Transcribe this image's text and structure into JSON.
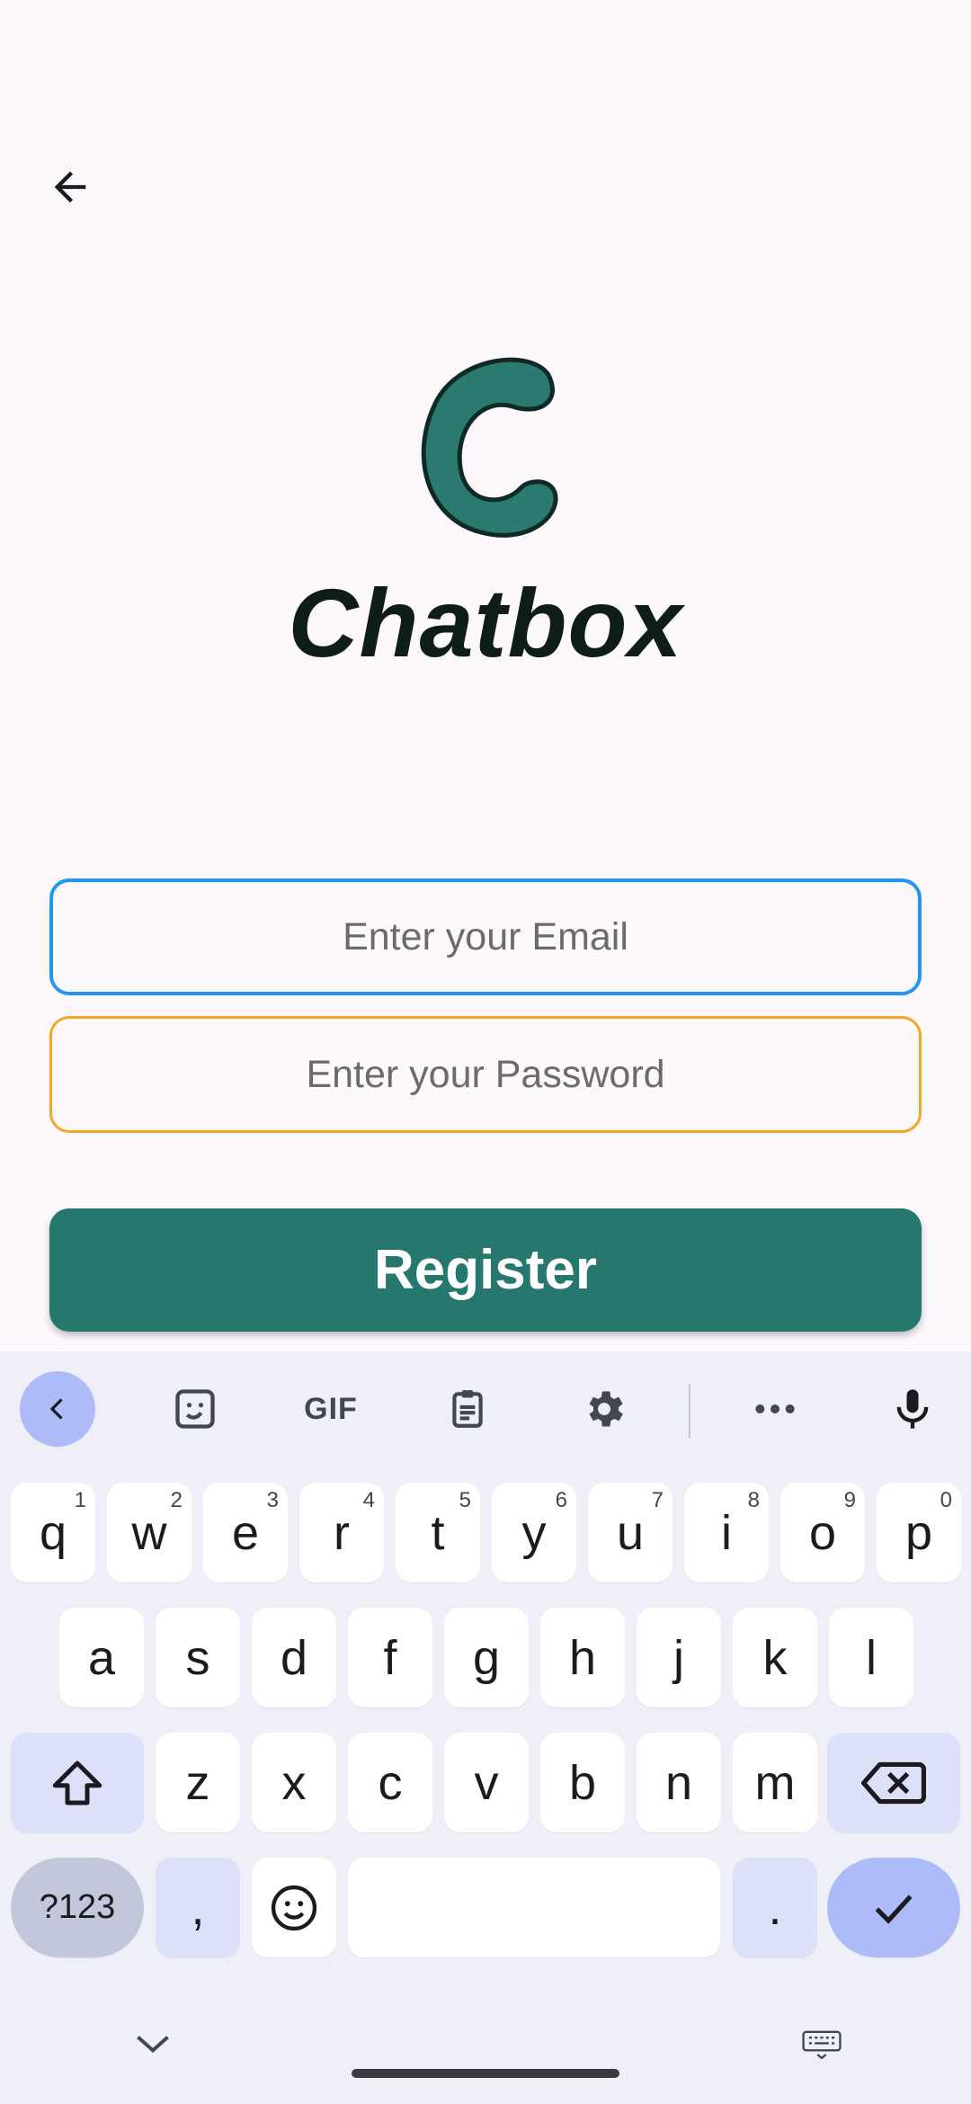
{
  "app": {
    "logo_text": "Chatbox",
    "brand_color": "#26776d",
    "back_icon": "arrow-left-icon"
  },
  "form": {
    "email_placeholder": "Enter your Email",
    "password_placeholder": "Enter your Password",
    "register_label": "Register",
    "email_border_color": "#2196f3",
    "password_border_color": "#f5a623"
  },
  "keyboard": {
    "toolbar": {
      "items": [
        "chevron-left-icon",
        "sticker-icon",
        "gif-icon",
        "clipboard-icon",
        "gear-icon",
        "more-icon",
        "mic-icon"
      ],
      "gif_label": "GIF"
    },
    "row1": [
      {
        "k": "q",
        "h": "1"
      },
      {
        "k": "w",
        "h": "2"
      },
      {
        "k": "e",
        "h": "3"
      },
      {
        "k": "r",
        "h": "4"
      },
      {
        "k": "t",
        "h": "5"
      },
      {
        "k": "y",
        "h": "6"
      },
      {
        "k": "u",
        "h": "7"
      },
      {
        "k": "i",
        "h": "8"
      },
      {
        "k": "o",
        "h": "9"
      },
      {
        "k": "p",
        "h": "0"
      }
    ],
    "row2": [
      "a",
      "s",
      "d",
      "f",
      "g",
      "h",
      "j",
      "k",
      "l"
    ],
    "row3": [
      "z",
      "x",
      "c",
      "v",
      "b",
      "n",
      "m"
    ],
    "row4": {
      "sym": "?123",
      "comma": ",",
      "period": "."
    }
  }
}
